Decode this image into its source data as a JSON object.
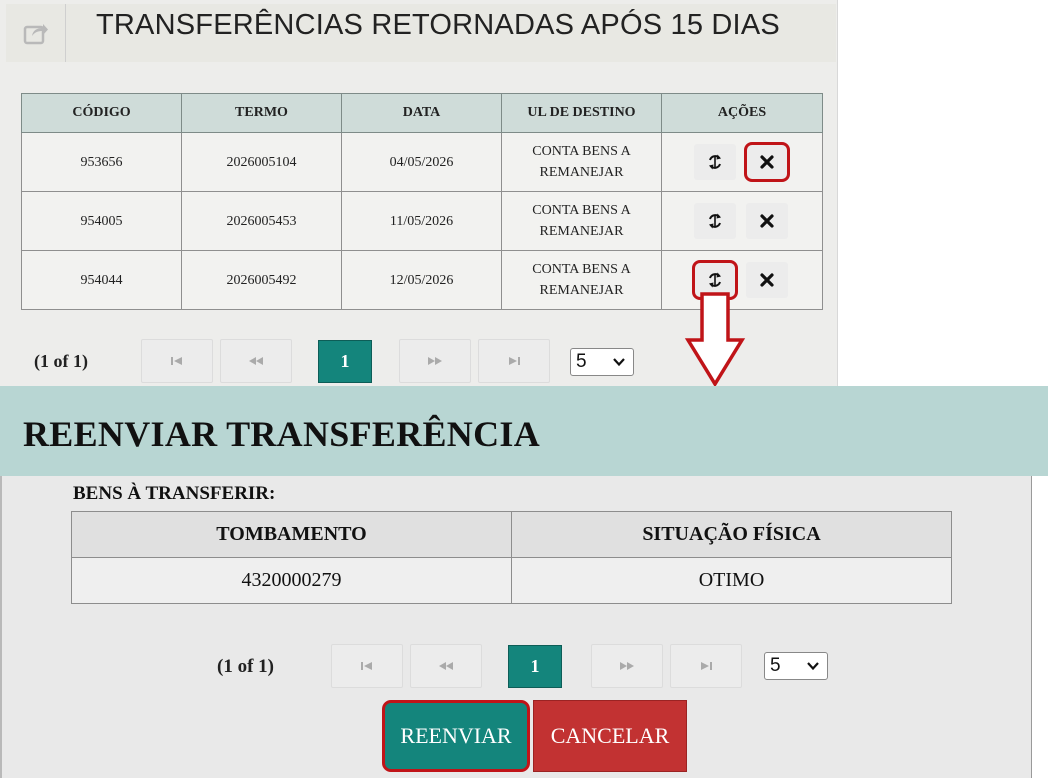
{
  "header": {
    "title": "TRANSFERÊNCIAS RETORNADAS APÓS 15 DIAS",
    "export_icon": "export-share-icon"
  },
  "transfers_table": {
    "columns": [
      "CÓDIGO",
      "TERMO",
      "DATA",
      "UL DE DESTINO",
      "AÇÕES"
    ],
    "rows": [
      {
        "codigo": "953656",
        "termo": "2026005104",
        "data": "04/05/2026",
        "destino_l1": "CONTA BENS A",
        "destino_l2": "REMANEJAR"
      },
      {
        "codigo": "954005",
        "termo": "2026005453",
        "data": "11/05/2026",
        "destino_l1": "CONTA BENS A",
        "destino_l2": "REMANEJAR"
      },
      {
        "codigo": "954044",
        "termo": "2026005492",
        "data": "12/05/2026",
        "destino_l1": "CONTA BENS A",
        "destino_l2": "REMANEJAR"
      }
    ],
    "action_icons": {
      "resend": "sync-icon",
      "cancel": "close-x-icon"
    }
  },
  "paginator_top": {
    "status": "(1 of 1)",
    "current_page": "1",
    "rows_per_page": "5"
  },
  "dialog": {
    "title": "REENVIAR TRANSFERÊNCIA",
    "goods_label": "BENS À TRANSFERIR:",
    "goods_table": {
      "columns": [
        "TOMBAMENTO",
        "SITUAÇÃO FÍSICA"
      ],
      "rows": [
        {
          "tombamento": "4320000279",
          "situacao": "OTIMO"
        }
      ]
    },
    "paginator": {
      "status": "(1 of 1)",
      "current_page": "1",
      "rows_per_page": "5"
    },
    "resend_label": "REENVIAR",
    "cancel_label": "CANCELAR"
  },
  "colors": {
    "teal": "#14857c",
    "highlight_red": "#c01418",
    "cancel_red": "#c23232",
    "dialog_header": "#b8d6d3",
    "table_header": "#cfdcd9"
  }
}
